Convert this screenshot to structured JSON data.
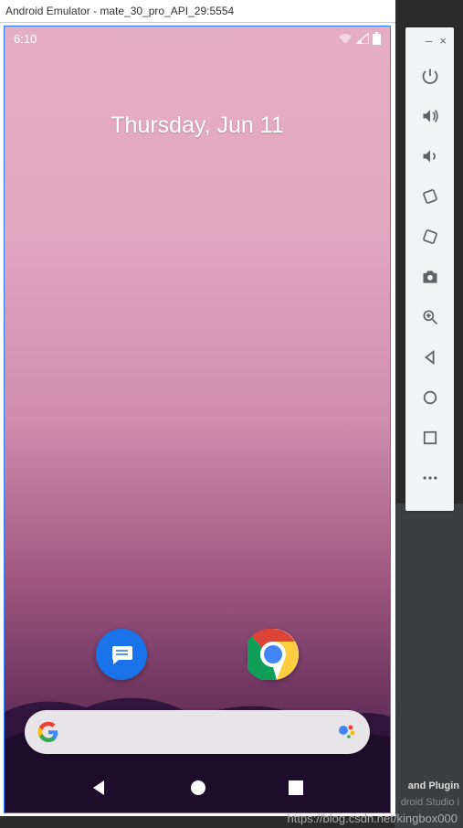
{
  "window": {
    "title": "Android Emulator - mate_30_pro_API_29:5554"
  },
  "status_bar": {
    "time": "6:10"
  },
  "home": {
    "date": "Thursday, Jun 11"
  },
  "apps": {
    "messages": "Messages",
    "chrome": "Chrome"
  },
  "search": {
    "placeholder": ""
  },
  "toolbar": {
    "minimize": "–",
    "close": "×",
    "items": [
      "power",
      "volume-up",
      "volume-down",
      "rotate-left",
      "rotate-right",
      "screenshot",
      "zoom",
      "back",
      "home",
      "overview",
      "more"
    ]
  },
  "background": {
    "text1": "and Plugin",
    "text2": "droid Studio i"
  },
  "watermark": "https://blog.csdn.net/kingbox000"
}
